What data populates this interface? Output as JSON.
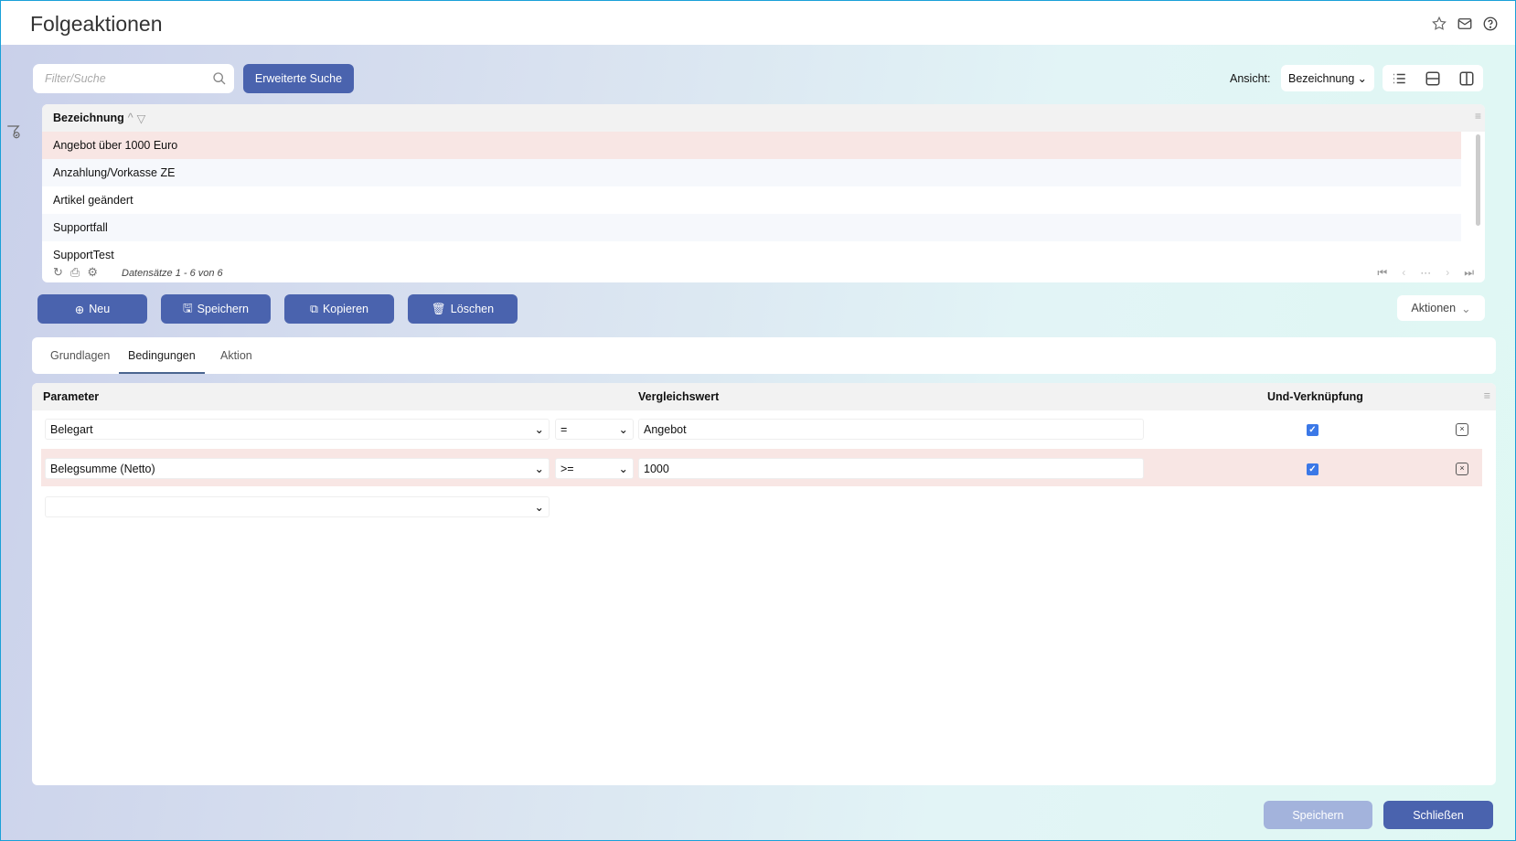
{
  "header": {
    "title": "Folgeaktionen",
    "icons": [
      "star-icon",
      "mail-icon",
      "help-icon"
    ]
  },
  "search": {
    "placeholder": "Filter/Suche",
    "advanced_label": "Erweiterte Suche"
  },
  "view": {
    "label": "Ansicht:",
    "selected": "Bezeichnung"
  },
  "grid": {
    "column": "Bezeichnung",
    "rows": [
      "Angebot über 1000 Euro",
      "Anzahlung/Vorkasse ZE",
      "Artikel geändert",
      "Supportfall",
      "SupportTest"
    ],
    "record_info": "Datensätze 1 - 6 von 6"
  },
  "toolbar": {
    "new": "Neu",
    "save": "Speichern",
    "copy": "Kopieren",
    "delete": "Löschen",
    "actions": "Aktionen"
  },
  "tabs": [
    "Grundlagen",
    "Bedingungen",
    "Aktion"
  ],
  "conditions": {
    "headers": {
      "parameter": "Parameter",
      "value": "Vergleichswert",
      "and": "Und-Verknüpfung"
    },
    "rows": [
      {
        "parameter": "Belegart",
        "operator": "=",
        "value": "Angebot",
        "and": true
      },
      {
        "parameter": "Belegsumme (Netto)",
        "operator": ">=",
        "value": "1000",
        "and": true
      }
    ]
  },
  "footer": {
    "save": "Speichern",
    "close": "Schließen"
  },
  "colors": {
    "accent": "#4a63ae",
    "selected_row": "#f8e6e4",
    "checkbox": "#3b78e7"
  }
}
